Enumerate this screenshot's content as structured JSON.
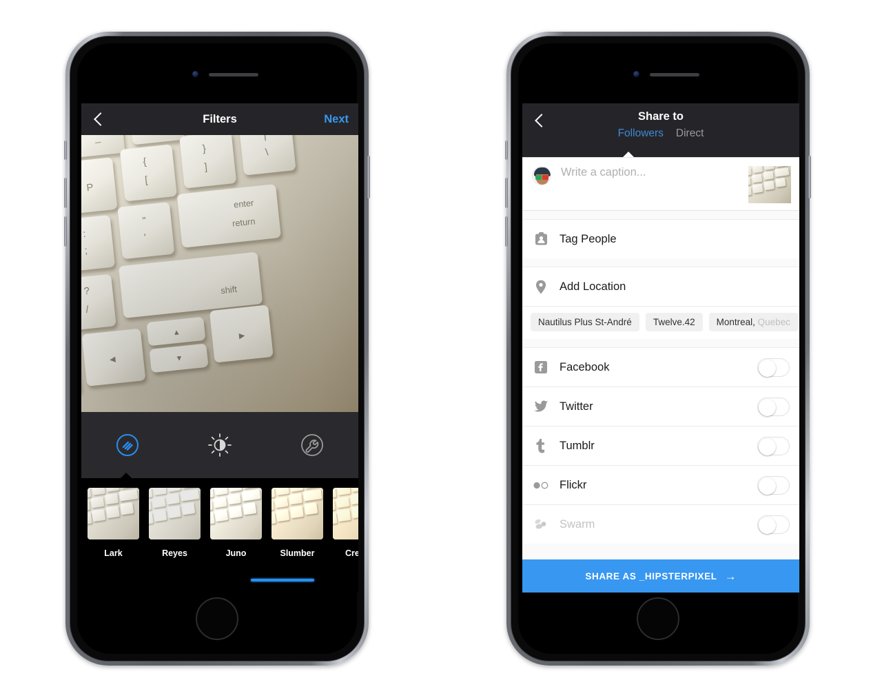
{
  "left_phone": {
    "nav": {
      "back_icon": "chevron-left-icon",
      "title": "Filters",
      "next_label": "Next"
    },
    "photo_alt": "close-up photo of a white Apple keyboard",
    "tools": [
      {
        "name": "filters-tool",
        "icon": "filters-icon",
        "active": true
      },
      {
        "name": "adjust-tool",
        "icon": "brightness-sun-icon",
        "active": false
      },
      {
        "name": "edit-tool",
        "icon": "wrench-edit-icon",
        "active": false
      }
    ],
    "filters": [
      {
        "label": "Lark",
        "selected": false
      },
      {
        "label": "Reyes",
        "selected": false
      },
      {
        "label": "Juno",
        "selected": false
      },
      {
        "label": "Slumber",
        "selected": true
      },
      {
        "label": "Crema",
        "selected": false
      }
    ]
  },
  "right_phone": {
    "nav": {
      "back_icon": "chevron-left-icon",
      "title": "Share to",
      "tabs": [
        {
          "label": "Followers",
          "active": true
        },
        {
          "label": "Direct",
          "active": false
        }
      ]
    },
    "caption": {
      "placeholder": "Write a caption...",
      "value": "",
      "avatar": "user-avatar"
    },
    "tag_people": {
      "icon": "tag-person-icon",
      "label": "Tag People"
    },
    "add_location": {
      "icon": "location-pin-icon",
      "label": "Add Location"
    },
    "location_chips": [
      {
        "label": "Nautilus Plus St-André",
        "truncated": ""
      },
      {
        "label": "Twelve.42",
        "truncated": ""
      },
      {
        "label": "Montreal, ",
        "truncated": "Quebec"
      }
    ],
    "services": [
      {
        "label": "Facebook",
        "icon": "facebook-icon",
        "on": false,
        "disabled": false
      },
      {
        "label": "Twitter",
        "icon": "twitter-icon",
        "on": false,
        "disabled": false
      },
      {
        "label": "Tumblr",
        "icon": "tumblr-icon",
        "on": false,
        "disabled": false
      },
      {
        "label": "Flickr",
        "icon": "flickr-icon",
        "on": false,
        "disabled": false
      },
      {
        "label": "Swarm",
        "icon": "swarm-icon",
        "on": false,
        "disabled": true
      }
    ],
    "share_button": {
      "label": "SHARE AS _HIPSTERPIXEL",
      "arrow": "→"
    }
  },
  "colors": {
    "accent_blue": "#3897f0",
    "nav_bar": "#252529",
    "tool_bar": "#2a2a2e",
    "tab_active": "#3f87d4",
    "tab_inactive": "#9a9a9e",
    "sheet_bg": "#fafafa",
    "page_bg": "#ffffff"
  }
}
